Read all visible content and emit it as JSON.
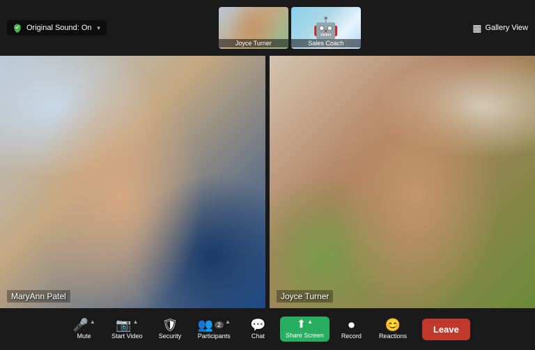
{
  "topBar": {
    "originalSound": "Original Sound: On",
    "galleryView": "Gallery View",
    "participants": [
      {
        "name": "Joyce Turner",
        "type": "person"
      },
      {
        "name": "Sales Coach",
        "type": "bot"
      }
    ]
  },
  "mainVideos": [
    {
      "name": "MaryAnn Patel",
      "side": "left"
    },
    {
      "name": "Joyce Turner",
      "side": "right"
    }
  ],
  "toolbar": {
    "buttons": [
      {
        "id": "mute",
        "label": "Mute",
        "icon": "🎤"
      },
      {
        "id": "video",
        "label": "Start Video",
        "icon": "📷"
      },
      {
        "id": "security",
        "label": "Security",
        "icon": "🛡"
      },
      {
        "id": "participants",
        "label": "Participants",
        "icon": "👥",
        "count": "2"
      },
      {
        "id": "chat",
        "label": "Chat",
        "icon": "💬"
      },
      {
        "id": "share",
        "label": "Share Screen",
        "icon": "↑"
      },
      {
        "id": "record",
        "label": "Record",
        "icon": "⏺"
      },
      {
        "id": "reactions",
        "label": "Reactions",
        "icon": "😊"
      }
    ],
    "leaveLabel": "Leave"
  }
}
